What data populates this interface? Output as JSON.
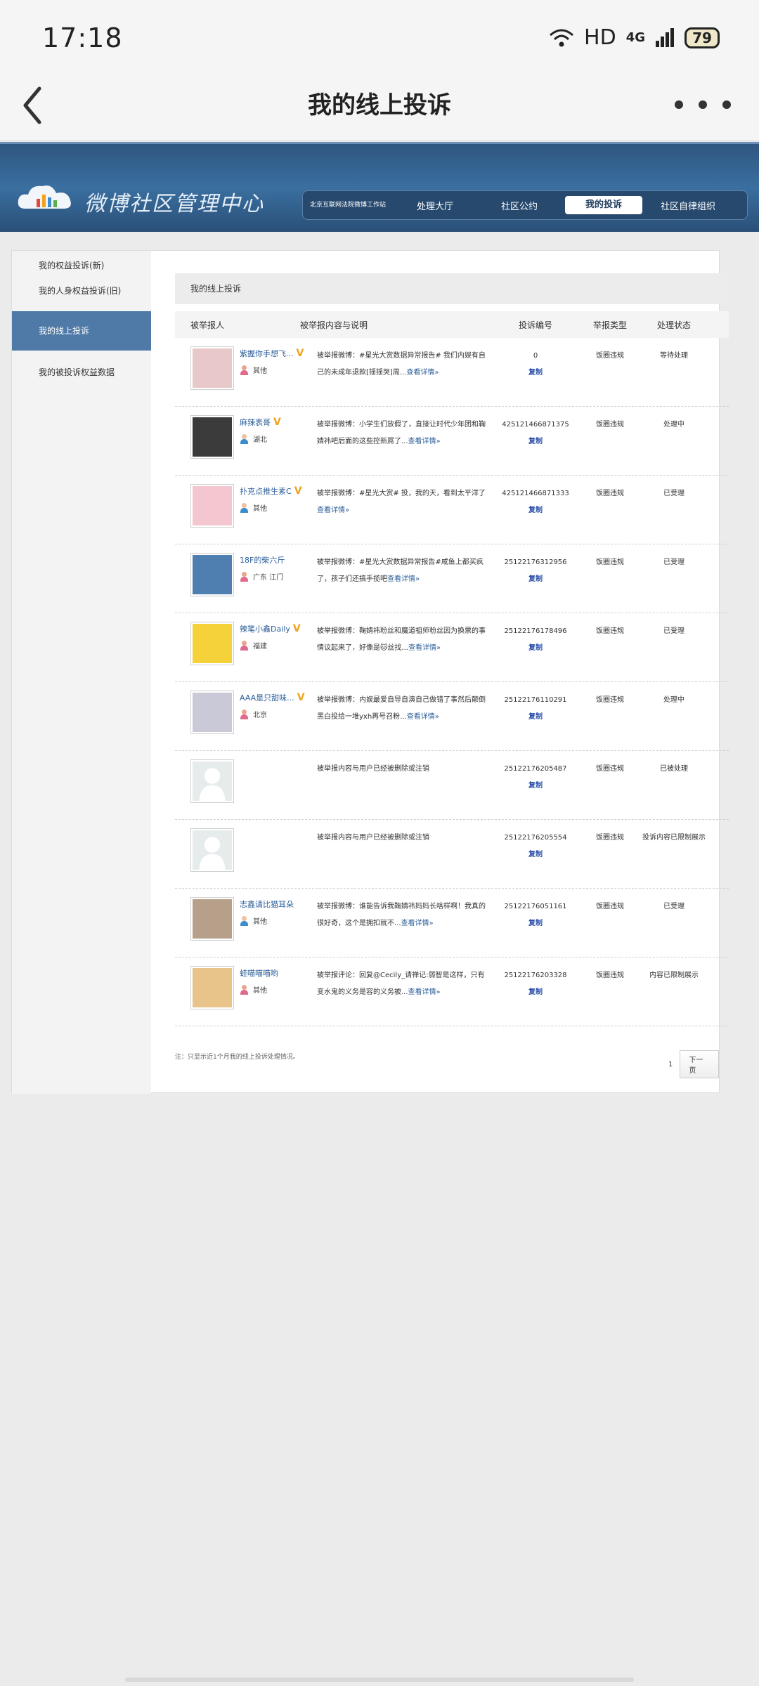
{
  "status_bar": {
    "time": "17:18",
    "network": "HD",
    "signal": "4G",
    "battery": "79"
  },
  "app_bar": {
    "title": "我的线上投诉"
  },
  "banner": {
    "brand": "微博社区管理中心",
    "nav": [
      {
        "label": "北京互联网法院微博工作站"
      },
      {
        "label": "处理大厅"
      },
      {
        "label": "社区公约"
      },
      {
        "label": "我的投诉",
        "active": true
      },
      {
        "label": "社区自律组织"
      }
    ]
  },
  "sidebar": {
    "items": [
      {
        "label": "我的权益投诉(新)"
      },
      {
        "label": "我的人身权益投诉(旧)"
      },
      {
        "label": "我的线上投诉",
        "active": true
      },
      {
        "label": "我的被投诉权益数据"
      }
    ]
  },
  "main": {
    "section_title": "我的线上投诉",
    "columns": [
      "被举报人",
      "被举报内容与说明",
      "投诉编号",
      "举报类型",
      "处理状态"
    ],
    "rows": [
      {
        "nick": "紫握你手想飞...",
        "verified": true,
        "gender": "female",
        "location": "其他",
        "content": "被举报微博：#星光大赏数据异常报告# 我们内娱有自己的未成年退款[揺揺哭]周...",
        "detail": "查看详情»",
        "id": "0",
        "copy": "复制",
        "type": "饭圈违规",
        "status": "等待处理"
      },
      {
        "nick": "麻辣表哥",
        "verified": true,
        "gender": "male",
        "location": "湖北",
        "content": "被举报微博：小学生们放假了，直接让时代少年团和鞠婧祎吧后面的这些控新屌了...",
        "detail": "查看详情»",
        "id": "425121466871375",
        "copy": "复制",
        "type": "饭圈违规",
        "status": "处理中"
      },
      {
        "nick": "扑克点推生素C",
        "verified": true,
        "gender": "male",
        "location": "其他",
        "content": "被举报微博：#星光大赏# 投，我的天，看到太平洋了",
        "detail": "查看详情»",
        "id": "425121466871333",
        "copy": "复制",
        "type": "饭圈违规",
        "status": "已受理"
      },
      {
        "nick": "18F的柴六斤",
        "verified": false,
        "gender": "female",
        "location": "广东  江门",
        "content": "被举报微博：#星光大赏数据异常报告#咸鱼上都买疯了，孩子们还搞手揽吧",
        "detail": "查看详情»",
        "id": "25122176312956",
        "copy": "复制",
        "type": "饭圈违规",
        "status": "已受理"
      },
      {
        "nick": "辣笔小鑫Daily",
        "verified": true,
        "gender": "female",
        "location": "福建",
        "content": "被举报微博：鞠婧祎粉丝和魔道祖师粉丝因为换票的事情议起来了，好像是🐱丝找...",
        "detail": "查看详情»",
        "id": "25122176178496",
        "copy": "复制",
        "type": "饭圈违规",
        "status": "已受理"
      },
      {
        "nick": "AAA是只甜味...",
        "verified": true,
        "gender": "female",
        "location": "北京",
        "content": "被举报微博：内娱最爱自导自演自己做错了事然后颠倒黑白投给一堆yxh再号召粉...",
        "detail": "查看详情»",
        "id": "25122176110291",
        "copy": "复制",
        "type": "饭圈违规",
        "status": "处理中"
      },
      {
        "nick": "",
        "verified": false,
        "gender": "",
        "location": "",
        "content": "被举报内容与用户已经被删除或注销",
        "detail": "",
        "id": "25122176205487",
        "copy": "复制",
        "type": "饭圈违规",
        "status": "已被处理"
      },
      {
        "nick": "",
        "verified": false,
        "gender": "",
        "location": "",
        "content": "被举报内容与用户已经被删除或注销",
        "detail": "",
        "id": "25122176205554",
        "copy": "复制",
        "type": "饭圈违规",
        "status": "投诉内容已限制展示"
      },
      {
        "nick": "志鑫请比猫耳朵",
        "verified": false,
        "gender": "male",
        "location": "其他",
        "content": "被举报微博：谁能告诉我鞠婧祎妈妈长啥样啊！我真的很好奇，这个是拥扣就不...",
        "detail": "查看详情»",
        "id": "25122176051161",
        "copy": "复制",
        "type": "饭圈违规",
        "status": "已受理"
      },
      {
        "nick": "蛙喵喵喵哟",
        "verified": false,
        "gender": "female",
        "location": "其他",
        "content": "被举报评论：回复@Cecily_请禅记:弱智是这样，只有变水鬼的义务是容的义务被...",
        "detail": "查看详情»",
        "id": "25122176203328",
        "copy": "复制",
        "type": "饭圈违规",
        "status": "内容已限制展示"
      }
    ],
    "footer_note": "注：只显示近1个月我的线上投诉处理情况。",
    "pager": {
      "page": "1",
      "next": "下一页"
    }
  }
}
